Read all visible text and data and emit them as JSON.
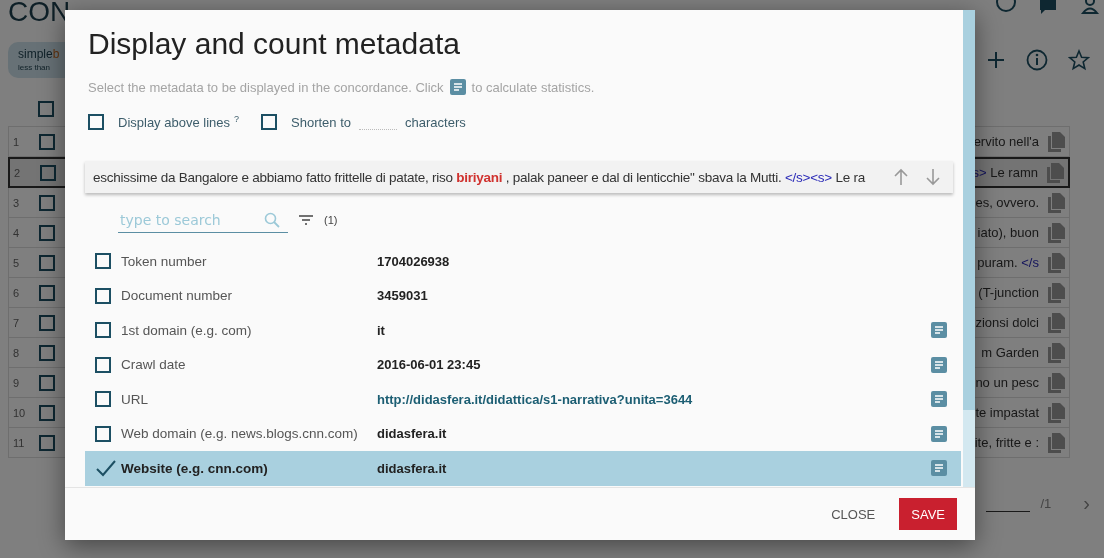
{
  "background": {
    "title": "CON",
    "chip": {
      "query": [
        {
          "text": "simple",
          "kind": "plain"
        },
        {
          "text": "b",
          "kind": "highlight"
        }
      ],
      "note": "less than"
    },
    "header_checkbox": {
      "checked": false
    },
    "rows": [
      {
        "number": "1",
        "checked": false,
        "selected": false,
        "fragment": [
          {
            "text": "ervito nell'a",
            "kind": "plain"
          }
        ]
      },
      {
        "number": "2",
        "checked": false,
        "selected": true,
        "fragment": [
          {
            "text": "s>",
            "kind": "tag"
          },
          {
            "text": " Le ramn",
            "kind": "plain"
          }
        ]
      },
      {
        "number": "3",
        "checked": false,
        "selected": false,
        "fragment": [
          {
            "text": "es, ovvero.",
            "kind": "plain"
          }
        ]
      },
      {
        "number": "4",
        "checked": false,
        "selected": false,
        "fragment": [
          {
            "text": "iato), buon",
            "kind": "plain"
          }
        ]
      },
      {
        "number": "5",
        "checked": false,
        "selected": false,
        "fragment": [
          {
            "text": "puram. ",
            "kind": "plain"
          },
          {
            "text": "</s",
            "kind": "tag"
          }
        ]
      },
      {
        "number": "6",
        "checked": false,
        "selected": false,
        "fragment": [
          {
            "text": "(T-junction",
            "kind": "plain"
          }
        ]
      },
      {
        "number": "7",
        "checked": false,
        "selected": false,
        "fragment": [
          {
            "text": "zionsi dolci",
            "kind": "plain"
          }
        ]
      },
      {
        "number": "8",
        "checked": false,
        "selected": false,
        "fragment": [
          {
            "text": "m Garden",
            "kind": "plain"
          }
        ]
      },
      {
        "number": "9",
        "checked": false,
        "selected": false,
        "fragment": [
          {
            "text": "no un pesc",
            "kind": "plain"
          }
        ]
      },
      {
        "number": "10",
        "checked": false,
        "selected": false,
        "fragment": [
          {
            "text": "te impastat",
            "kind": "plain"
          }
        ]
      },
      {
        "number": "11",
        "checked": false,
        "selected": false,
        "fragment": [
          {
            "text": "ite, fritte e :",
            "kind": "plain"
          }
        ]
      }
    ],
    "pager": {
      "total": "/1",
      "next": "›"
    }
  },
  "dialog": {
    "title": "Display and count metadata",
    "hint_before": "Select the metadata to be displayed in the concordance. Click",
    "hint_after": "to calculate statistics.",
    "display_above": {
      "label": "Display above lines",
      "note": "?",
      "checked": false
    },
    "shorten": {
      "label": "Shorten to",
      "suffix": "characters",
      "checked": false
    },
    "concordance": [
      {
        "text": "eschissime da Bangalore e abbiamo fatto frittelle di patate, riso ",
        "kind": "plain"
      },
      {
        "text": "biriyani",
        "kind": "keyword"
      },
      {
        "text": " , palak paneer e dal di lenticchie\" sbava la Mutti. ",
        "kind": "plain"
      },
      {
        "text": "</s><s>",
        "kind": "tag"
      },
      {
        "text": " Le ra",
        "kind": "plain"
      }
    ],
    "search": {
      "placeholder": "type to search"
    },
    "filter_count": "(1)",
    "metadata": [
      {
        "label": "Token number",
        "value": "1704026938",
        "kind": "text",
        "checked": false,
        "stats": false
      },
      {
        "label": "Document number",
        "value": "3459031",
        "kind": "text",
        "checked": false,
        "stats": false
      },
      {
        "label": "1st domain (e.g. com)",
        "value": "it",
        "kind": "text",
        "checked": false,
        "stats": true
      },
      {
        "label": "Crawl date",
        "value": "2016-06-01 23:45",
        "kind": "text",
        "checked": false,
        "stats": true
      },
      {
        "label": "URL",
        "value": "http://didasfera.it/didattica/s1-narrativa?unita=3644",
        "kind": "link",
        "checked": false,
        "stats": true
      },
      {
        "label": "Web domain (e.g. news.blogs.cnn.com)",
        "value": "didasfera.it",
        "kind": "text",
        "checked": false,
        "stats": true
      },
      {
        "label": "Website (e.g. cnn.com)",
        "value": "didasfera.it",
        "kind": "text",
        "checked": true,
        "stats": true
      }
    ],
    "buttons": [
      {
        "label": "CLOSE",
        "kind": "flat"
      },
      {
        "label": "SAVE",
        "kind": "primary"
      }
    ]
  }
}
